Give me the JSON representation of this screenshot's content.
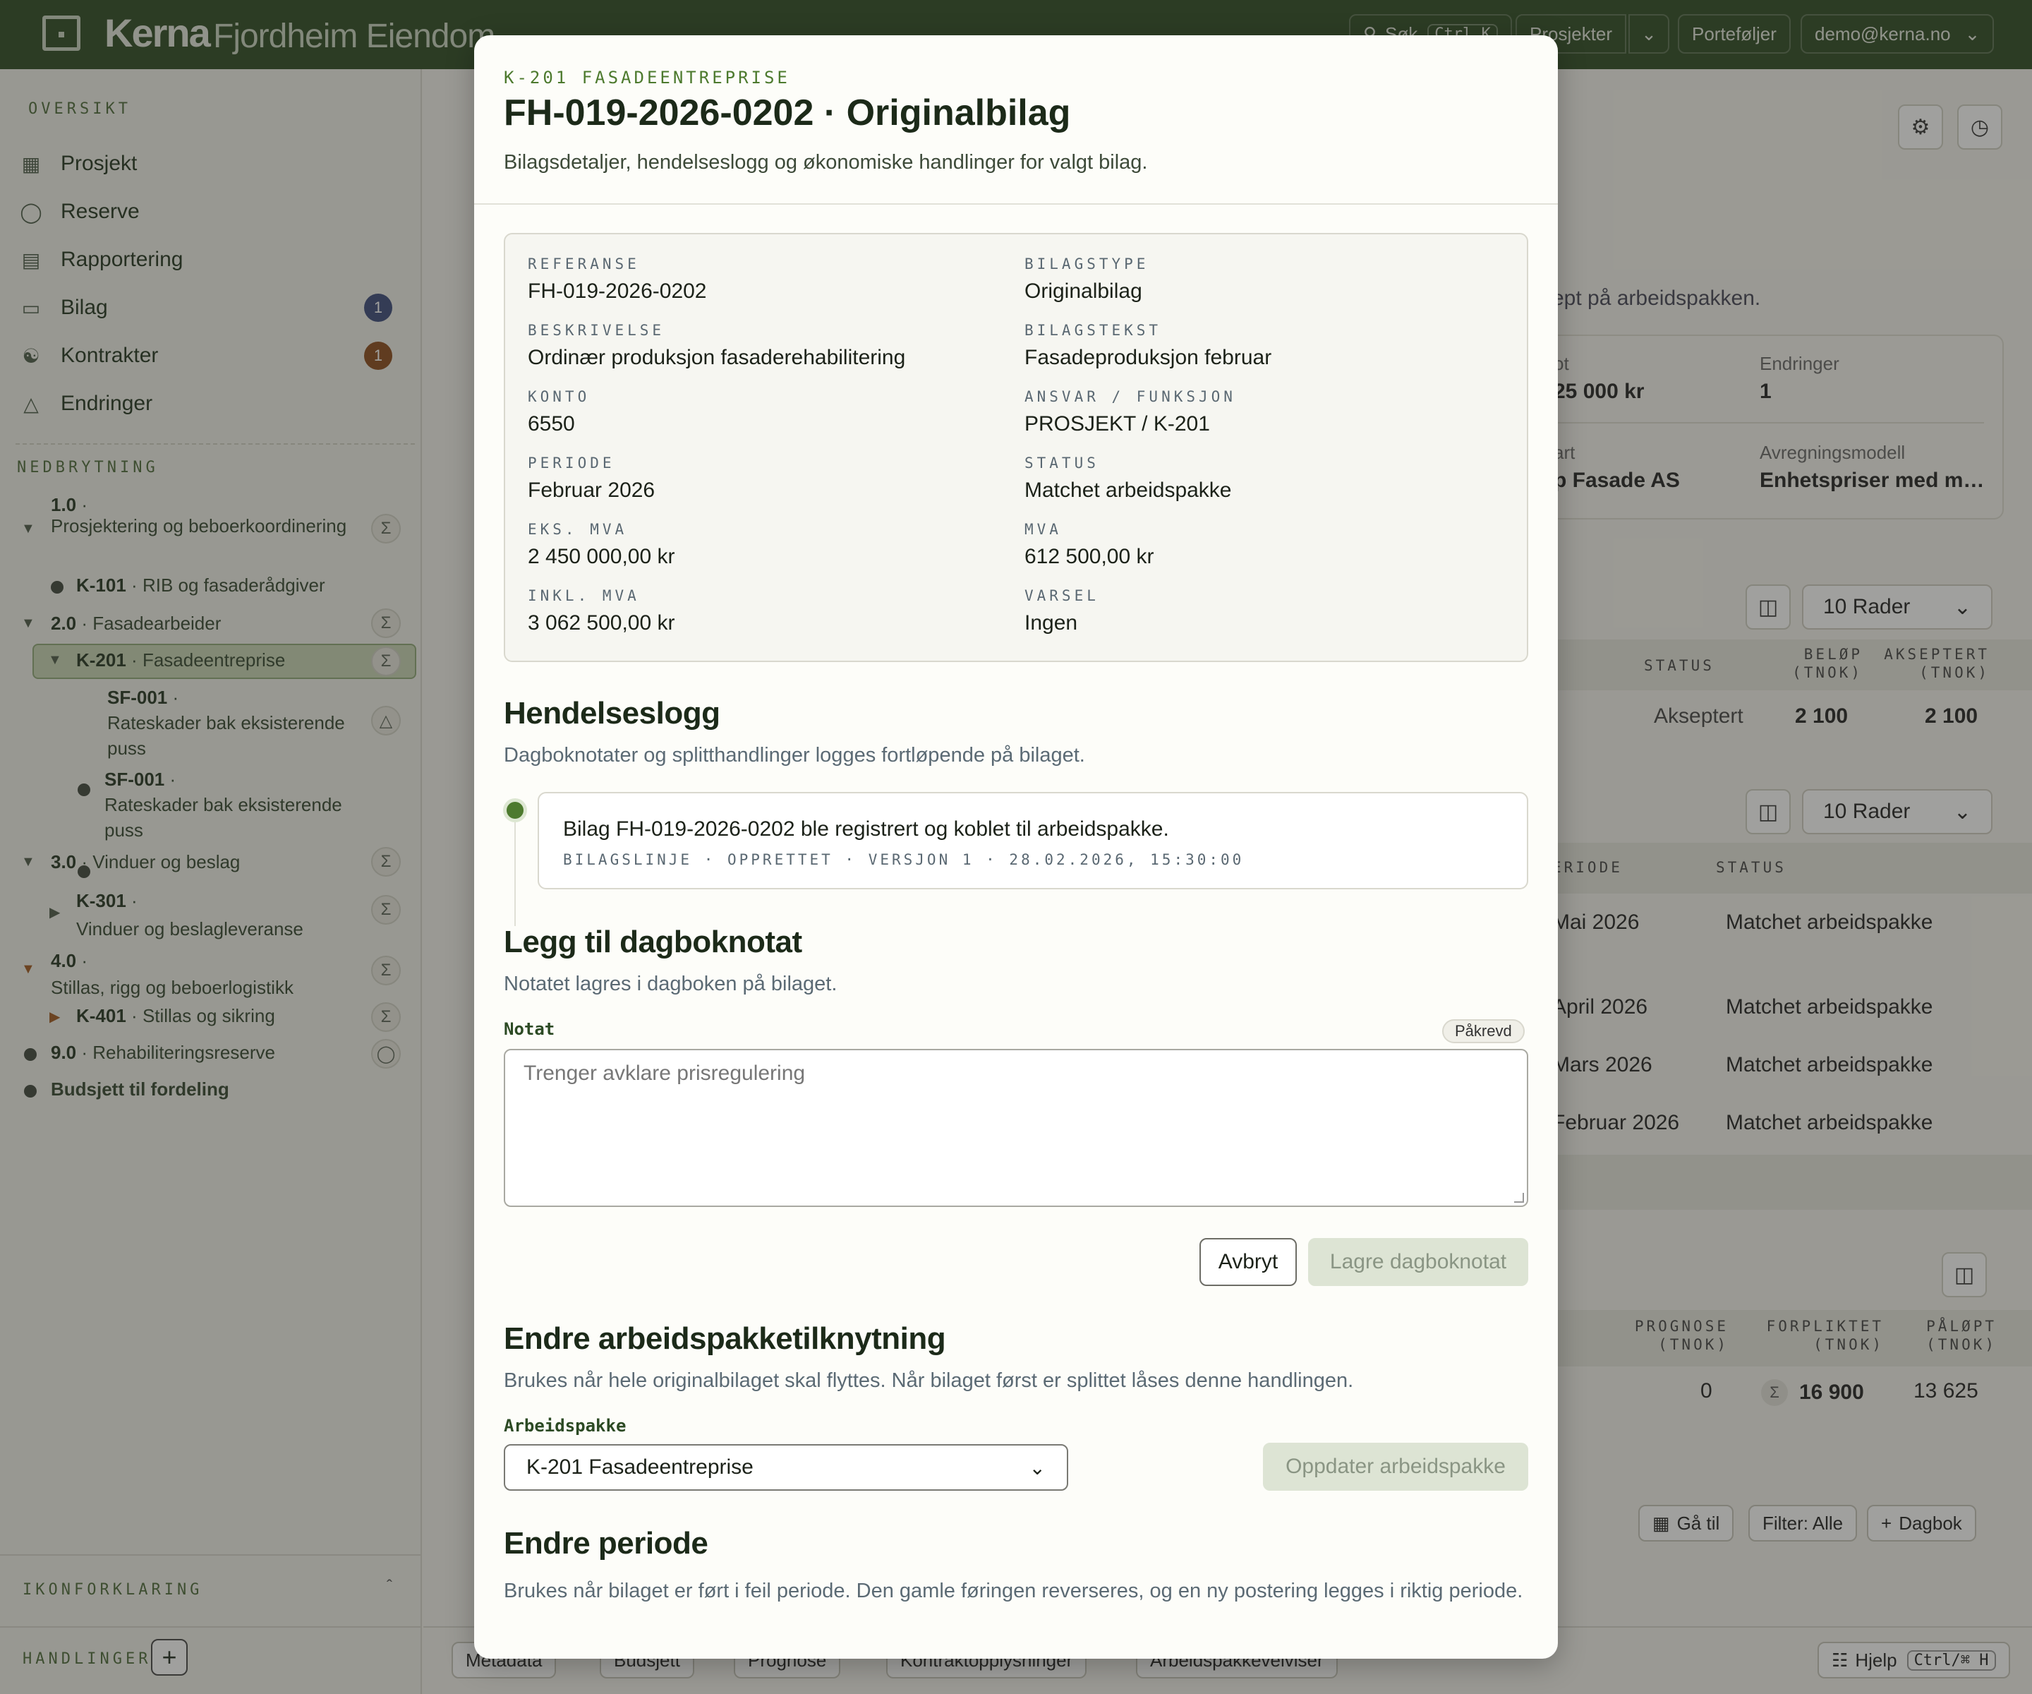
{
  "topbar": {
    "brand": "Kerna",
    "org": "Fjordheim Eiendom",
    "search_label": "Søk",
    "search_shortcut": "Ctrl K",
    "projects_label": "Prosjekter",
    "portfolios_label": "Porteføljer",
    "user_email": "demo@kerna.no"
  },
  "sidebar": {
    "overview_heading": "OVERSIKT",
    "nav": [
      {
        "label": "Prosjekt",
        "icon": "grid-icon"
      },
      {
        "label": "Reserve",
        "icon": "shield-icon"
      },
      {
        "label": "Rapportering",
        "icon": "report-icon"
      },
      {
        "label": "Bilag",
        "icon": "inbox-icon",
        "badge": "1",
        "badge_color": "#3b4a7a"
      },
      {
        "label": "Kontrakter",
        "icon": "handshake-icon",
        "badge": "1",
        "badge_color": "#8a4a1a"
      },
      {
        "label": "Endringer",
        "icon": "triangle-icon"
      }
    ],
    "breakdown_heading": "NEDBRYTNING",
    "tree": [
      {
        "code": "1.0",
        "name": "Prosjektering og beboerkoordinering"
      },
      {
        "code": "K-101",
        "name": "RIB og fasaderådgiver"
      },
      {
        "code": "2.0",
        "name": "Fasadearbeider"
      },
      {
        "code": "K-201",
        "name": "Fasadeentreprise"
      },
      {
        "code": "SF-001",
        "name": "Rateskader bak eksisterende puss"
      },
      {
        "code": "SF-001",
        "name": "Rateskader bak eksisterende puss"
      },
      {
        "code": "3.0",
        "name": "Vinduer og beslag"
      },
      {
        "code": "K-301",
        "name": "Vinduer og beslagleveranse"
      },
      {
        "code": "4.0",
        "name": "Stillas, rigg og beboerlogistikk"
      },
      {
        "code": "K-401",
        "name": "Stillas og sikring"
      },
      {
        "code": "9.0",
        "name": "Rehabiliteringsreserve"
      },
      {
        "code": "",
        "name": "Budsjett til fordeling"
      }
    ],
    "legend_heading": "IKONFORKLARING",
    "actions_heading": "HANDLINGER"
  },
  "background": {
    "intro_fragment": "ept på arbeidspakken.",
    "summary": {
      "label_a": "ot",
      "value_a": "25 000 kr",
      "label_changes": "Endringer",
      "value_changes": "1",
      "label_b": "art",
      "value_b": "p Fasade AS",
      "label_model": "Avregningsmodell",
      "value_model": "Enhetspriser med m…"
    },
    "rows_select": "10 Rader",
    "table1": {
      "headers": [
        "STATUS",
        "BELØP (TNOK)",
        "AKSEPTERT (TNOK)"
      ],
      "row": [
        "Akseptert",
        "2 100",
        "2 100"
      ]
    },
    "table2": {
      "headers": [
        "ERIODE",
        "STATUS"
      ],
      "rows": [
        [
          "Mai 2026",
          "Matchet arbeidspakke"
        ],
        [
          "April 2026",
          "Matchet arbeidspakke"
        ],
        [
          "Mars 2026",
          "Matchet arbeidspakke"
        ],
        [
          "Februar 2026",
          "Matchet arbeidspakke"
        ]
      ]
    },
    "table3": {
      "headers": [
        "PROGNOSE (TNOK)",
        "FORPLIKTET (TNOK)",
        "PÅLØPT (TNOK)"
      ],
      "row": [
        "0",
        "16 900",
        "13 625"
      ]
    },
    "toolbar": {
      "goto": "Gå til",
      "filter": "Filter: Alle",
      "diary": "Dagbok"
    },
    "bottom_buttons": [
      "Metadata",
      "Budsjett",
      "Prognose",
      "Kontraktopplysninger",
      "Arbeidspakkevelviser"
    ],
    "help_label": "Hjelp",
    "help_shortcut": "Ctrl/⌘ H"
  },
  "modal": {
    "eyebrow": "K-201 FASADEENTREPRISE",
    "title": "FH-019-2026-0202 · Originalbilag",
    "subtitle": "Bilagsdetaljer, hendelseslogg og økonomiske handlinger for valgt bilag.",
    "details": [
      {
        "label": "REFERANSE",
        "value": "FH-019-2026-0202"
      },
      {
        "label": "BILAGSTYPE",
        "value": "Originalbilag"
      },
      {
        "label": "BESKRIVELSE",
        "value": "Ordinær produksjon fasaderehabilitering"
      },
      {
        "label": "BILAGSTEKST",
        "value": "Fasadeproduksjon februar"
      },
      {
        "label": "KONTO",
        "value": "6550"
      },
      {
        "label": "ANSVAR / FUNKSJON",
        "value": "PROSJEKT / K-201"
      },
      {
        "label": "PERIODE",
        "value": "Februar 2026"
      },
      {
        "label": "STATUS",
        "value": "Matchet arbeidspakke"
      },
      {
        "label": "EKS. MVA",
        "value": "2 450 000,00 kr"
      },
      {
        "label": "MVA",
        "value": "612 500,00 kr"
      },
      {
        "label": "INKL. MVA",
        "value": "3 062 500,00 kr"
      },
      {
        "label": "VARSEL",
        "value": "Ingen"
      }
    ],
    "log": {
      "heading": "Hendelseslogg",
      "description": "Dagboknotater og splitthandlinger logges fortløpende på bilaget.",
      "entry_text": "Bilag FH-019-2026-0202 ble registrert og koblet til arbeidspakke.",
      "entry_meta": "BILAGSLINJE · OPPRETTET · VERSJON 1 · 28.02.2026, 15:30:00"
    },
    "note": {
      "heading": "Legg til dagboknotat",
      "description": "Notatet lagres i dagboken på bilaget.",
      "field_label": "Notat",
      "required_badge": "Påkrevd",
      "placeholder": "Trenger avklare prisregulering",
      "cancel_label": "Avbryt",
      "save_label": "Lagre dagboknotat"
    },
    "workpackage": {
      "heading": "Endre arbeidspakketilknytning",
      "description": "Brukes når hele originalbilaget skal flyttes. Når bilaget først er splittet låses denne handlingen.",
      "field_label": "Arbeidspakke",
      "selected": "K-201 Fasadeentreprise",
      "update_label": "Oppdater arbeidspakke"
    },
    "period": {
      "heading": "Endre periode",
      "description": "Brukes når bilaget er ført i feil periode. Den gamle føringen reverseres, og en ny postering legges i riktig periode."
    }
  }
}
